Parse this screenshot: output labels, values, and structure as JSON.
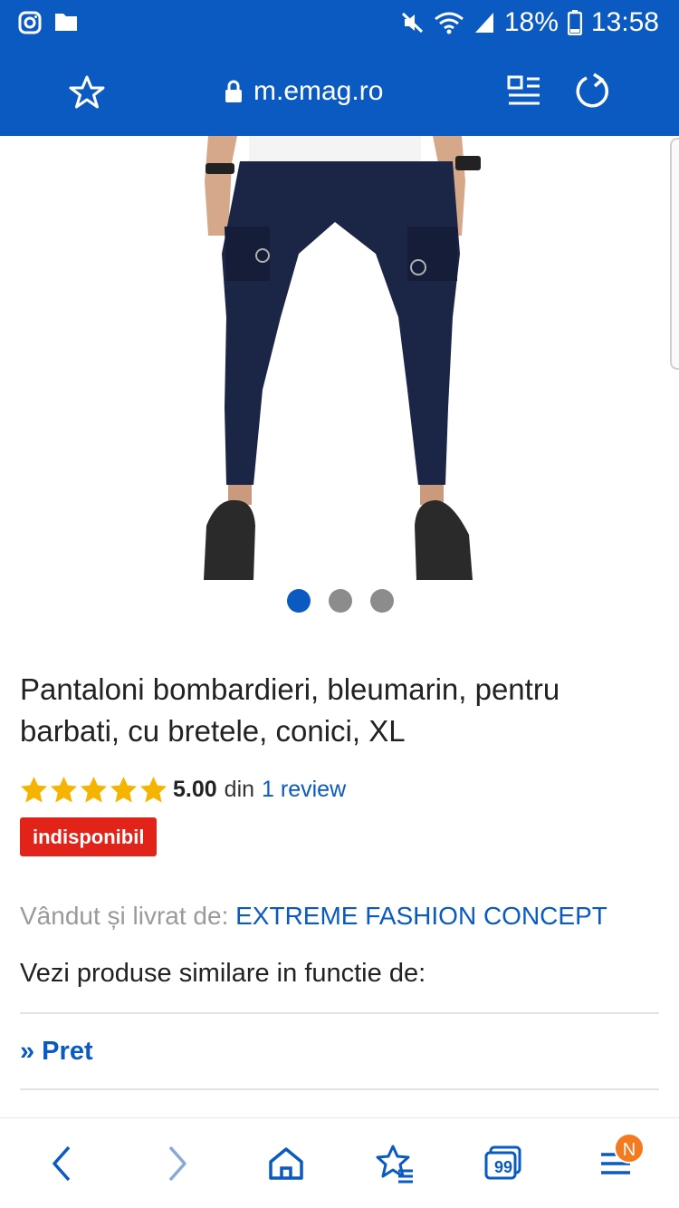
{
  "status_bar": {
    "battery": "18%",
    "time": "13:58",
    "icons": [
      "instagram-icon",
      "folder-icon",
      "mute-icon",
      "wifi-icon",
      "signal-icon",
      "battery-icon"
    ]
  },
  "browser": {
    "url": "m.emag.ro",
    "icons": [
      "bookmark-star-icon",
      "lock-icon",
      "reader-mode-icon",
      "reload-icon"
    ]
  },
  "product": {
    "image_alt": "product-image",
    "carousel_dots": 3,
    "carousel_active": 0,
    "title": "Pantaloni bombardieri, bleumarin, pentru barbati, cu bretele, conici, XL",
    "rating_value": "5.00",
    "rating_text": "din",
    "review_link": "1 review",
    "stars": 5,
    "availability_badge": "indisponibil",
    "seller_label": "Vândut și livrat de:",
    "seller_name": "EXTREME FASHION CONCEPT",
    "similar_label": "Vezi produse similare in functie de:",
    "filter_link": "» Pret"
  },
  "bottom_nav": {
    "notification_badge": "N",
    "tabs_count": "99",
    "icons": [
      "back-icon",
      "forward-icon",
      "home-icon",
      "bookmarks-icon",
      "tabs-icon",
      "menu-icon"
    ]
  },
  "colors": {
    "brand_blue": "#0a5ac2",
    "badge_red": "#e2231a",
    "star_yellow": "#f5b400",
    "notif_orange": "#f47a1f"
  }
}
